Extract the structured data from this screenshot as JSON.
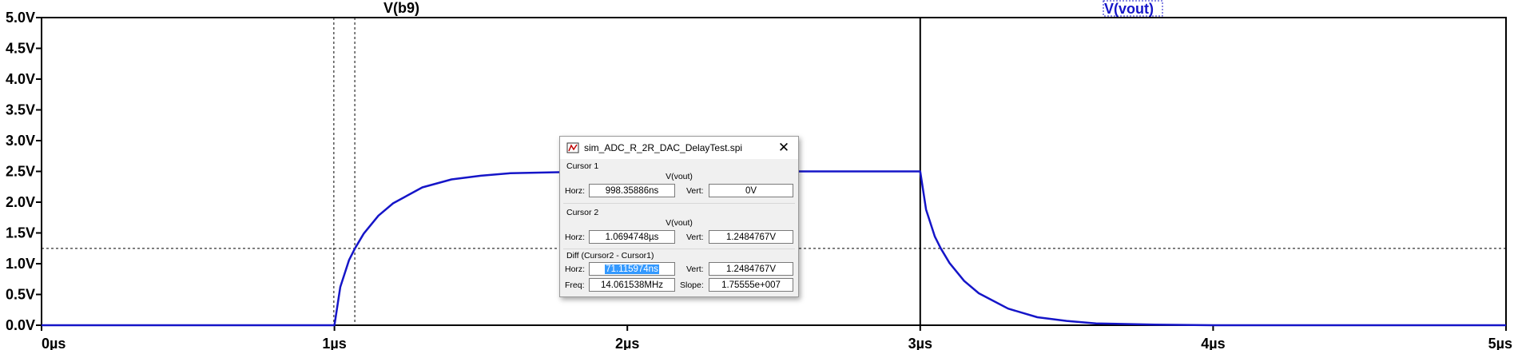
{
  "chart_data": {
    "type": "line",
    "xlim": [
      0,
      5
    ],
    "ylim": [
      0,
      5
    ],
    "x_ticks": [
      {
        "value": 0,
        "label": "0µs"
      },
      {
        "value": 1,
        "label": "1µs"
      },
      {
        "value": 2,
        "label": "2µs"
      },
      {
        "value": 3,
        "label": "3µs"
      },
      {
        "value": 4,
        "label": "4µs"
      },
      {
        "value": 5,
        "label": "5µs"
      }
    ],
    "y_ticks": [
      {
        "value": 0.0,
        "label": "0.0V"
      },
      {
        "value": 0.5,
        "label": "0.5V"
      },
      {
        "value": 1.0,
        "label": "1.0V"
      },
      {
        "value": 1.5,
        "label": "1.5V"
      },
      {
        "value": 2.0,
        "label": "2.0V"
      },
      {
        "value": 2.5,
        "label": "2.5V"
      },
      {
        "value": 3.0,
        "label": "3.0V"
      },
      {
        "value": 3.5,
        "label": "3.5V"
      },
      {
        "value": 4.0,
        "label": "4.0V"
      },
      {
        "value": 4.5,
        "label": "4.5V"
      },
      {
        "value": 5.0,
        "label": "5.0V"
      }
    ],
    "grid": false,
    "series": [
      {
        "name": "V(b9)",
        "color": "#000000",
        "x": [
          0,
          5
        ],
        "y": [
          0,
          0
        ]
      },
      {
        "name": "V(vout)",
        "color": "#1515c8",
        "x": [
          0,
          1.0,
          1.02,
          1.05,
          1.07,
          1.1,
          1.15,
          1.2,
          1.3,
          1.4,
          1.5,
          1.6,
          1.7,
          1.8,
          2.0,
          2.5,
          2.99,
          3.0,
          3.02,
          3.05,
          3.07,
          3.1,
          3.15,
          3.2,
          3.3,
          3.4,
          3.5,
          3.6,
          3.8,
          4.0,
          5.0
        ],
        "y": [
          0,
          0,
          0.62,
          1.06,
          1.25,
          1.49,
          1.78,
          1.98,
          2.24,
          2.37,
          2.43,
          2.47,
          2.48,
          2.49,
          2.5,
          2.5,
          2.5,
          2.5,
          1.88,
          1.44,
          1.25,
          1.01,
          0.72,
          0.52,
          0.27,
          0.13,
          0.07,
          0.03,
          0.01,
          0.0,
          0.0
        ]
      }
    ],
    "cursors": {
      "vertical_x": [
        0.998,
        1.0695,
        3.0
      ],
      "horizontal_y": [
        1.2485
      ]
    }
  },
  "dialog": {
    "title": "sim_ADC_R_2R_DAC_DelayTest.spi",
    "close_symbol": "✕",
    "cursor1": {
      "section": "Cursor 1",
      "trace": "V(vout)",
      "horz_label": "Horz:",
      "horz_value": "998.35886ns",
      "vert_label": "Vert:",
      "vert_value": "0V"
    },
    "cursor2": {
      "section": "Cursor 2",
      "trace": "V(vout)",
      "horz_label": "Horz:",
      "horz_value": "1.0694748µs",
      "vert_label": "Vert:",
      "vert_value": "1.2484767V"
    },
    "diff": {
      "section": "Diff (Cursor2 - Cursor1)",
      "horz_label": "Horz:",
      "horz_value": "71.115974ns",
      "vert_label": "Vert:",
      "vert_value": "1.2484767V",
      "freq_label": "Freq:",
      "freq_value": "14.061538MHz",
      "slope_label": "Slope:",
      "slope_value": "1.75555e+007"
    }
  }
}
